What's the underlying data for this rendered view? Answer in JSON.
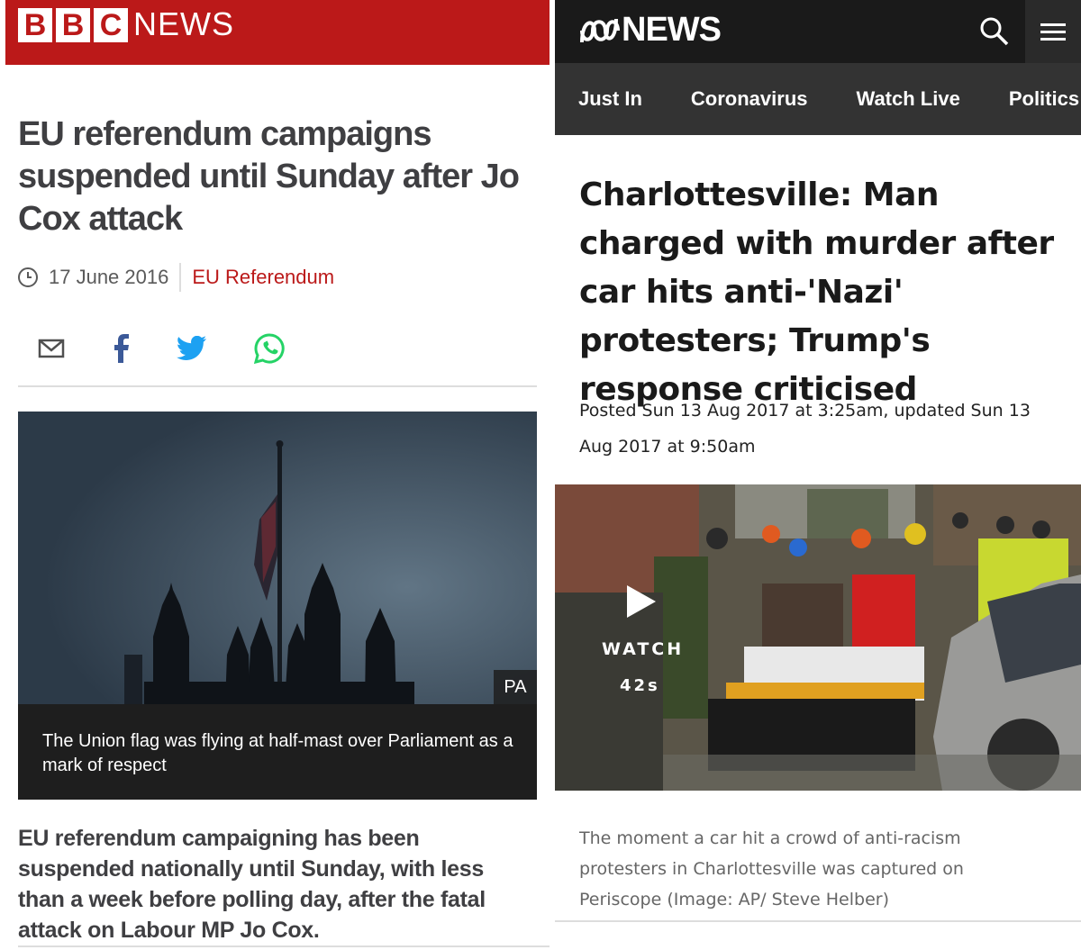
{
  "bbc": {
    "logo_letters": [
      "B",
      "B",
      "C"
    ],
    "logo_text": "NEWS",
    "headline": "EU referendum campaigns suspended until Sunday after Jo Cox attack",
    "date": "17 June 2016",
    "category": "EU Referendum",
    "share_icons": [
      "email-icon",
      "facebook-icon",
      "twitter-icon",
      "whatsapp-icon"
    ],
    "image_credit": "PA",
    "image_caption": "The Union flag was flying at half-mast over Parliament as a mark of respect",
    "intro": "EU referendum campaigning has been suspended nationally until Sunday, with less than a week before polling day, after the fatal attack on Labour MP Jo Cox.",
    "colors": {
      "brand": "#bb1919",
      "caption_bg": "#1e1e1e"
    }
  },
  "abc": {
    "logo_text": "NEWS",
    "nav": [
      "Just In",
      "Coronavirus",
      "Watch Live",
      "Politics"
    ],
    "headline": "Charlottesville: Man charged with murder after car hits anti-'Nazi' protesters; Trump's response criticised",
    "posted": "Posted Sun 13 Aug 2017 at 3:25am, updated Sun 13 Aug 2017 at 9:50am",
    "video": {
      "label": "WATCH",
      "duration": "42s"
    },
    "image_caption": "The moment a car hit a crowd of anti-racism protesters in Charlottesville was captured on Periscope (Image: AP/ Steve Helber)",
    "colors": {
      "header_bg": "#1a1a1a",
      "nav_bg": "#333333"
    }
  }
}
